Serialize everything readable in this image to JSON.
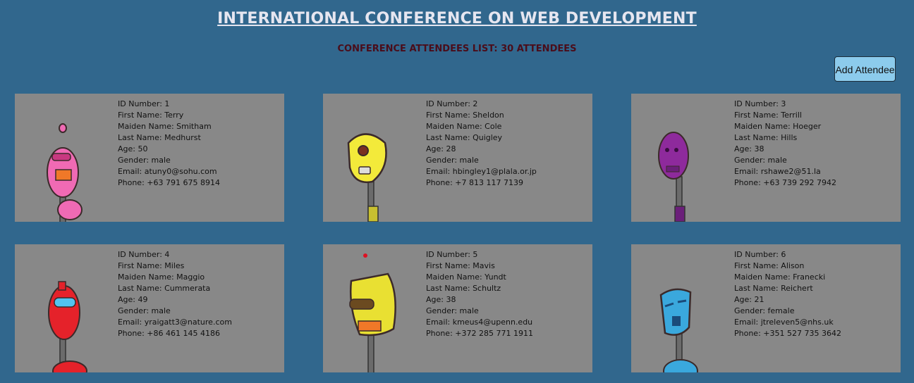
{
  "header": {
    "title": "INTERNATIONAL CONFERENCE ON WEB DEVELOPMENT",
    "subtitle": "CONFERENCE ATTENDEES LIST: 30 ATTENDEES",
    "add_button_label": "Add Attendee"
  },
  "labels": {
    "id": "ID Number: ",
    "first": "First Name: ",
    "maiden": "Maiden Name: ",
    "last": "Last Name: ",
    "age": "Age: ",
    "gender": "Gender: ",
    "email": "Email: ",
    "phone": "Phone: "
  },
  "attendees": [
    {
      "id": "1",
      "first": "Terry",
      "maiden": "Smitham",
      "last": "Medhurst",
      "age": "50",
      "gender": "male",
      "email": "atuny0@sohu.com",
      "phone": "+63 791 675 8914",
      "avatar": "pink-robot-icon",
      "color": "#f06ab4"
    },
    {
      "id": "2",
      "first": "Sheldon",
      "maiden": "Cole",
      "last": "Quigley",
      "age": "28",
      "gender": "male",
      "email": "hbingley1@plala.or.jp",
      "phone": "+7 813 117 7139",
      "avatar": "yellow-robot-icon",
      "color": "#f3ea3a"
    },
    {
      "id": "3",
      "first": "Terrill",
      "maiden": "Hoeger",
      "last": "Hills",
      "age": "38",
      "gender": "male",
      "email": "rshawe2@51.la",
      "phone": "+63 739 292 7942",
      "avatar": "purple-robot-icon",
      "color": "#8e2a9c"
    },
    {
      "id": "4",
      "first": "Miles",
      "maiden": "Maggio",
      "last": "Cummerata",
      "age": "49",
      "gender": "male",
      "email": "yraigatt3@nature.com",
      "phone": "+86 461 145 4186",
      "avatar": "red-robot-icon",
      "color": "#e5222a"
    },
    {
      "id": "5",
      "first": "Mavis",
      "maiden": "Yundt",
      "last": "Schultz",
      "age": "38",
      "gender": "male",
      "email": "kmeus4@upenn.edu",
      "phone": "+372 285 771 1911",
      "avatar": "yellow-antenna-robot-icon",
      "color": "#e9e032"
    },
    {
      "id": "6",
      "first": "Alison",
      "maiden": "Franecki",
      "last": "Reichert",
      "age": "21",
      "gender": "female",
      "email": "jtreleven5@nhs.uk",
      "phone": "+351 527 735 3642",
      "avatar": "blue-robot-icon",
      "color": "#3aa8dd"
    }
  ]
}
